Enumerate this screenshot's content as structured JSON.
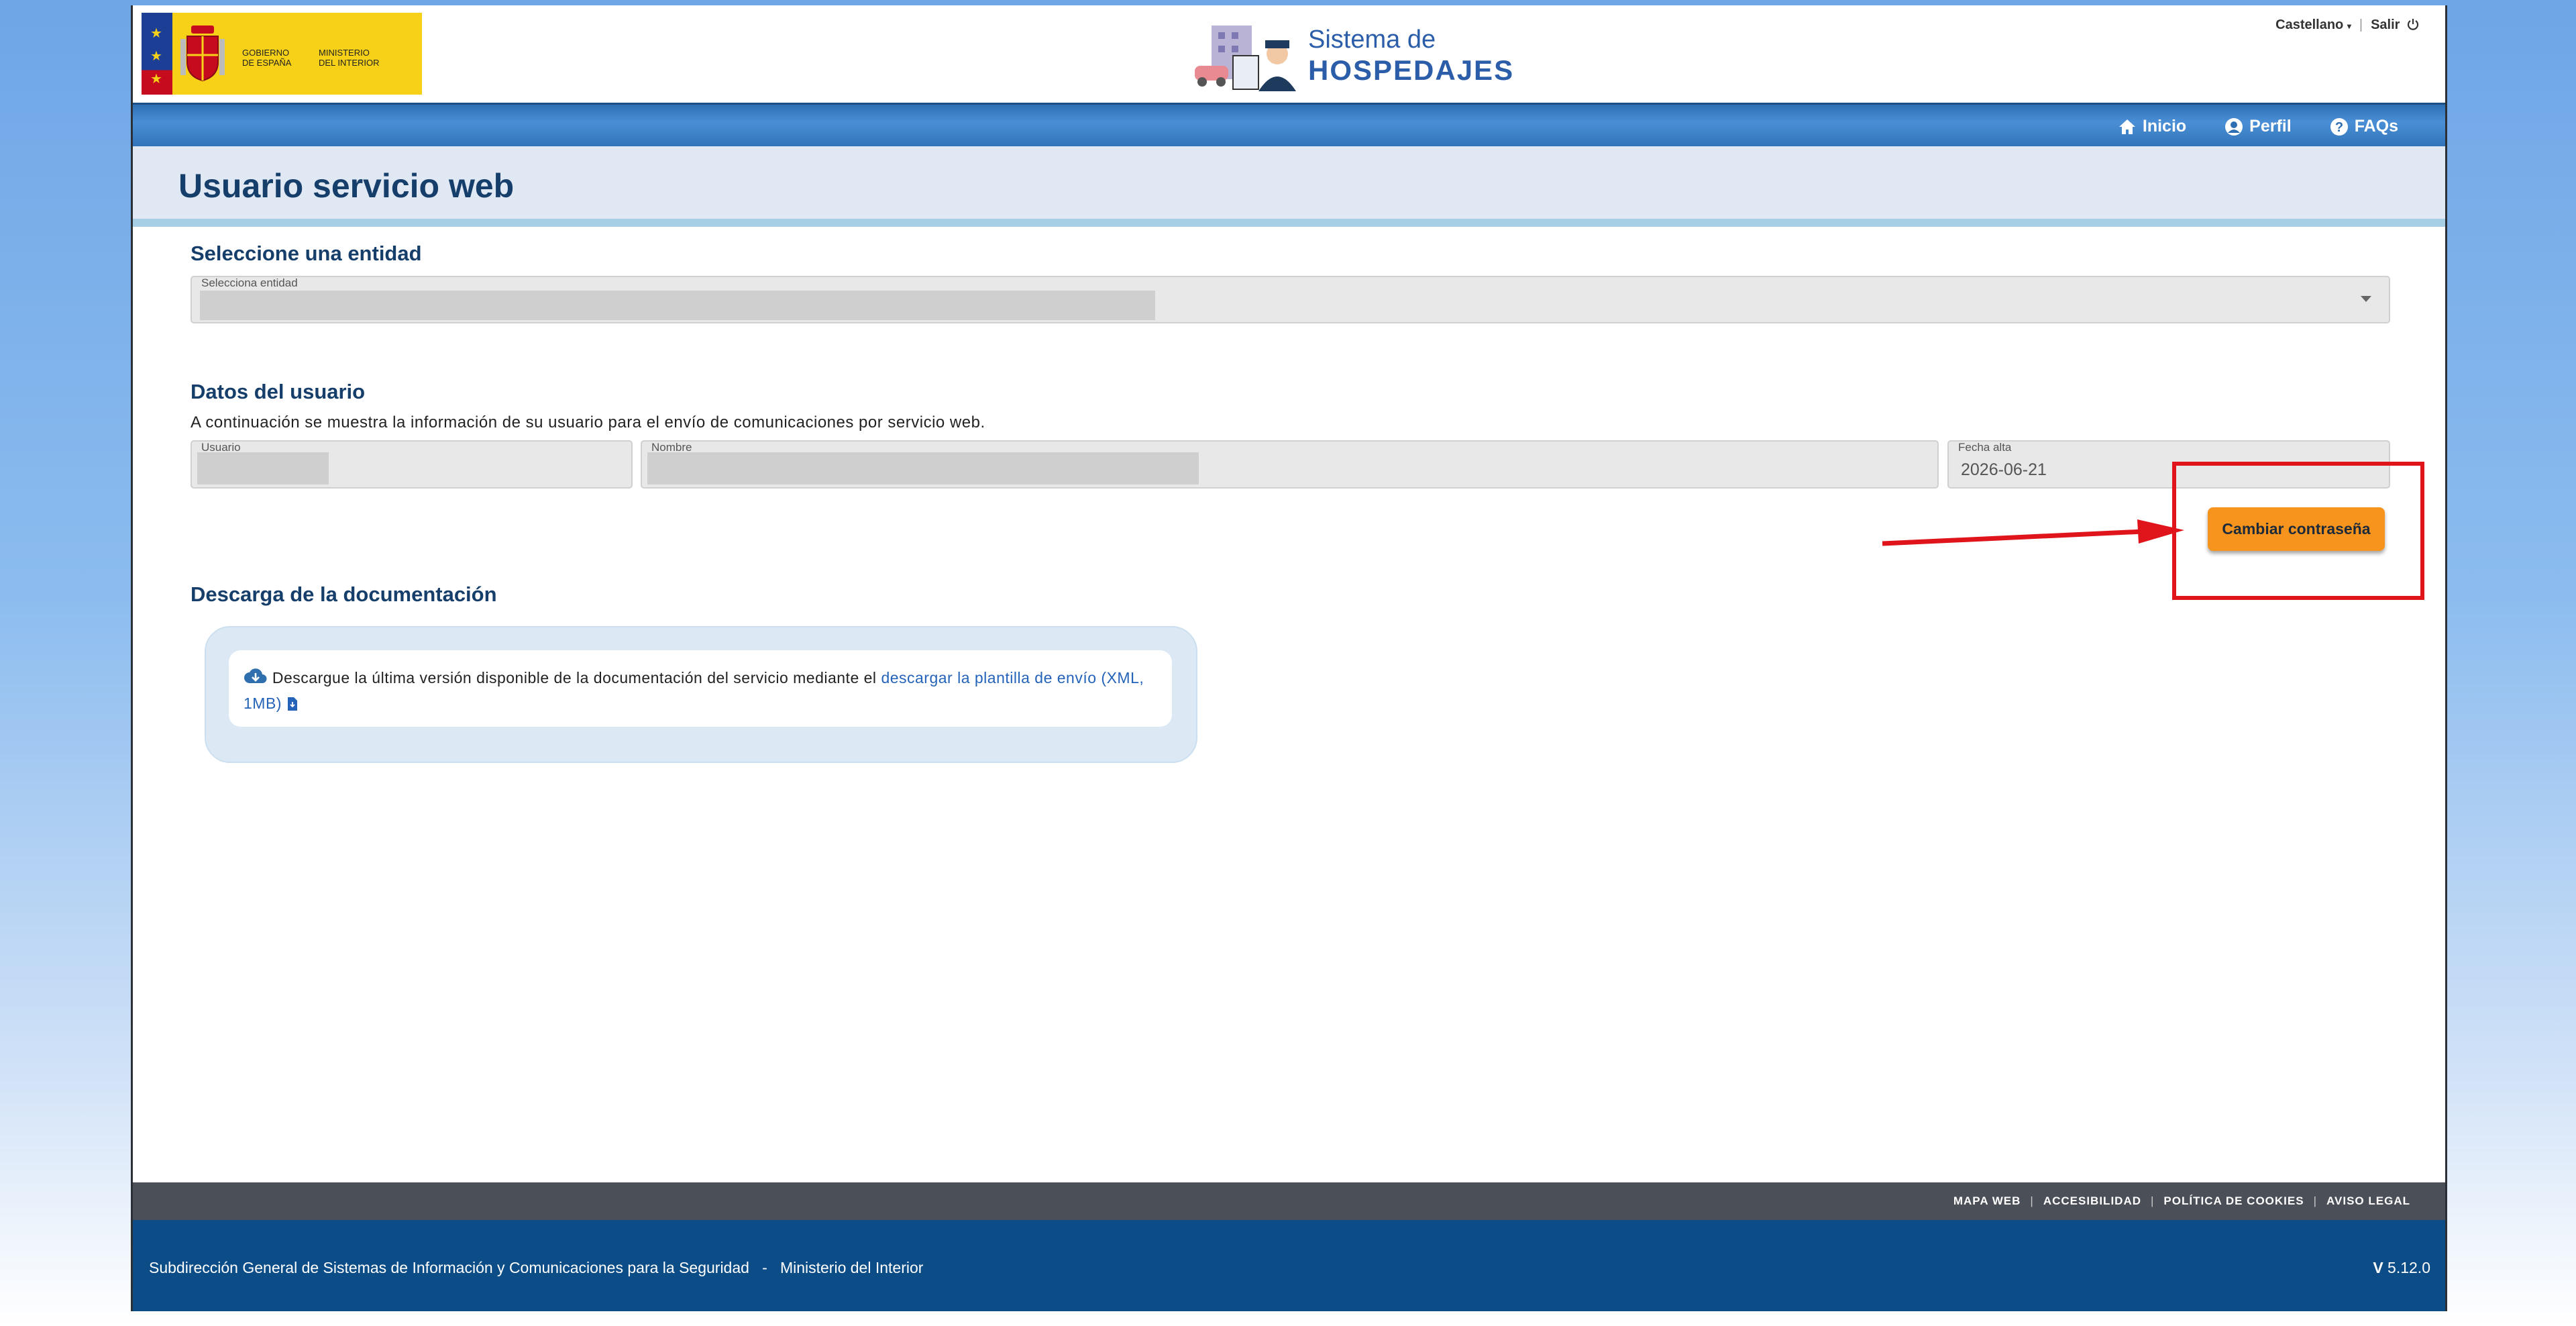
{
  "header": {
    "logo": {
      "line1": "GOBIERNO",
      "line2": "DE ESPAÑA",
      "line3": "MINISTERIO",
      "line4": "DEL INTERIOR"
    },
    "brand": {
      "title_line1": "Sistema de",
      "title_line2": "HOSPEDAJES"
    },
    "language": "Castellano",
    "logout": "Salir"
  },
  "nav": {
    "items": [
      {
        "label": "Inicio",
        "icon": "home-icon"
      },
      {
        "label": "Perfil",
        "icon": "user-circle-icon"
      },
      {
        "label": "FAQs",
        "icon": "question-circle-icon"
      }
    ]
  },
  "page": {
    "title": "Usuario servicio web"
  },
  "entity_section": {
    "title": "Seleccione una entidad",
    "select_label": "Selecciona entidad"
  },
  "user_section": {
    "title": "Datos del usuario",
    "intro": "A continuación se muestra la información de su usuario para el envío de comunicaciones por servicio web.",
    "fields": {
      "usuario_label": "Usuario",
      "nombre_label": "Nombre",
      "fecha_alta_label": "Fecha alta",
      "fecha_alta_value": "2026-06-21"
    },
    "change_password_button": "Cambiar contraseña"
  },
  "docs_section": {
    "title": "Descarga de la documentación",
    "text": "Descargue la última versión disponible de la documentación del servicio mediante el",
    "link": "descargar la plantilla de envío (XML, 1MB)"
  },
  "footer": {
    "links": [
      "MAPA WEB",
      "ACCESIBILIDAD",
      "POLÍTICA DE COOKIES",
      "AVISO LEGAL"
    ],
    "org": "Subdirección General de Sistemas de Información y Comunicaciones para la Seguridad",
    "ministry": "Ministerio del Interior",
    "version_prefix": "V",
    "version": "5.12.0"
  },
  "colors": {
    "primary": "#163e6b",
    "nav_blue": "#2e6fb3",
    "accent_orange": "#f7941d",
    "highlight_red": "#e0151c",
    "footer_blue": "#0d4d87"
  }
}
